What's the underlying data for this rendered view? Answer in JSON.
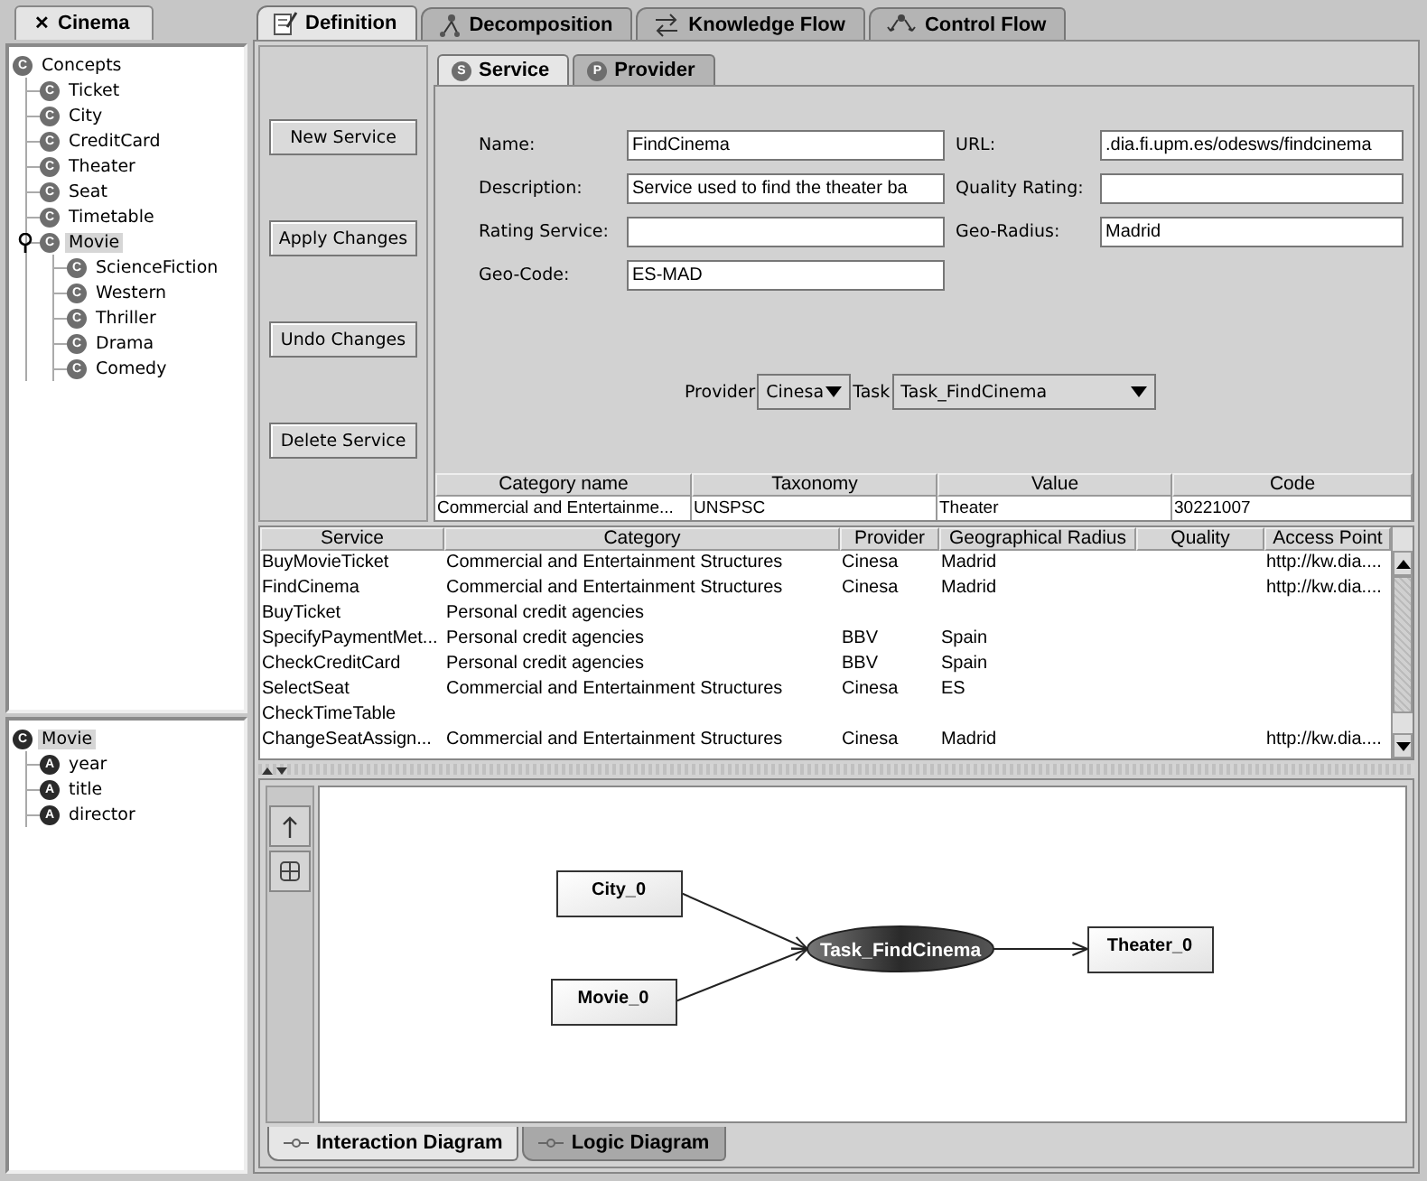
{
  "project_tab": {
    "label": "Cinema",
    "close": "✕"
  },
  "concept_tree": [
    {
      "label": "Concepts",
      "badge": "C",
      "selected": false,
      "children": [
        {
          "label": "Ticket",
          "badge": "C",
          "selected": false
        },
        {
          "label": "City",
          "badge": "C",
          "selected": false
        },
        {
          "label": "CreditCard",
          "badge": "C",
          "selected": false
        },
        {
          "label": "Theater",
          "badge": "C",
          "selected": false
        },
        {
          "label": "Seat",
          "badge": "C",
          "selected": false
        },
        {
          "label": "Timetable",
          "badge": "C",
          "selected": false
        },
        {
          "label": "Movie",
          "badge": "C",
          "selected": true,
          "expanded": true,
          "children": [
            {
              "label": "ScienceFiction",
              "badge": "C",
              "selected": false
            },
            {
              "label": "Western",
              "badge": "C",
              "selected": false
            },
            {
              "label": "Thriller",
              "badge": "C",
              "selected": false
            },
            {
              "label": "Drama",
              "badge": "C",
              "selected": false
            },
            {
              "label": "Comedy",
              "badge": "C",
              "selected": false
            }
          ]
        }
      ]
    }
  ],
  "attribute_tree": [
    {
      "label": "Movie",
      "badge": "C",
      "selected": true,
      "children": [
        {
          "label": "year",
          "badge": "A",
          "selected": false
        },
        {
          "label": "title",
          "badge": "A",
          "selected": false
        },
        {
          "label": "director",
          "badge": "A",
          "selected": false
        }
      ]
    }
  ],
  "main_tabs": [
    {
      "label": "Definition",
      "kind": "definition",
      "selected": true
    },
    {
      "label": "Decomposition",
      "kind": "decomposition",
      "selected": false
    },
    {
      "label": "Knowledge Flow",
      "kind": "knowledge",
      "selected": false
    },
    {
      "label": "Control Flow",
      "kind": "control",
      "selected": false
    }
  ],
  "actions": [
    "New Service",
    "Apply Changes",
    "Undo Changes",
    "Delete Service"
  ],
  "sub_tabs": [
    {
      "label": "Service",
      "badge": "S",
      "selected": true
    },
    {
      "label": "Provider",
      "badge": "P",
      "selected": false
    }
  ],
  "fields_left": [
    {
      "label": "Name:",
      "value": "FindCinema"
    },
    {
      "label": "Description:",
      "value": "Service used to find the theater ba"
    },
    {
      "label": "Rating Service:"
    },
    {
      "label": "Geo-Code:",
      "value": "ES-MAD"
    }
  ],
  "fields_right": [
    {
      "label": "URL:",
      "value": ".dia.fi.upm.es/odesws/findcinema"
    },
    {
      "label": "Quality Rating:"
    },
    {
      "label": "Geo-Radius:",
      "value": "Madrid"
    }
  ],
  "selectors": [
    {
      "label": "Provider",
      "value": "Cinesa"
    },
    {
      "label": "Task",
      "value": "Task_FindCinema"
    }
  ],
  "category_table": {
    "columns": [
      "Category name",
      "Taxonomy",
      "Value",
      "Code"
    ],
    "rows": [
      [
        "Commercial and Entertainme...",
        "UNSPSC",
        "Theater",
        "30221007"
      ]
    ]
  },
  "services_table": {
    "columns": [
      "Service",
      "Category",
      "Provider",
      "Geographical Radius",
      "Quality",
      "Access Point"
    ],
    "rows": [
      [
        "BuyMovieTicket",
        "Commercial and Entertainment Structures",
        "Cinesa",
        "Madrid",
        null,
        "http://kw.dia...."
      ],
      [
        "FindCinema",
        "Commercial and Entertainment Structures",
        "Cinesa",
        "Madrid",
        null,
        "http://kw.dia...."
      ],
      [
        "BuyTicket",
        "Personal credit agencies",
        null,
        null,
        null,
        null
      ],
      [
        "SpecifyPaymentMet...",
        "Personal credit agencies",
        "BBV",
        "Spain",
        null,
        null
      ],
      [
        "CheckCreditCard",
        "Personal credit agencies",
        "BBV",
        "Spain",
        null,
        null
      ],
      [
        "SelectSeat",
        "Commercial and Entertainment Structures",
        "Cinesa",
        "ES",
        null,
        null
      ],
      [
        "CheckTimeTable",
        null,
        null,
        null,
        null,
        null
      ],
      [
        "ChangeSeatAssign...",
        "Commercial and Entertainment Structures",
        "Cinesa",
        "Madrid",
        null,
        "http://kw.dia...."
      ]
    ]
  },
  "diagram": {
    "nodes": [
      {
        "label": "City_0",
        "kind": "concept"
      },
      {
        "label": "Movie_0",
        "kind": "concept"
      },
      {
        "label": "Task_FindCinema",
        "kind": "task"
      },
      {
        "label": "Theater_0",
        "kind": "concept"
      }
    ]
  },
  "diagram_tabs": [
    {
      "label": "Interaction Diagram",
      "selected": true
    },
    {
      "label": "Logic Diagram",
      "selected": false
    }
  ]
}
